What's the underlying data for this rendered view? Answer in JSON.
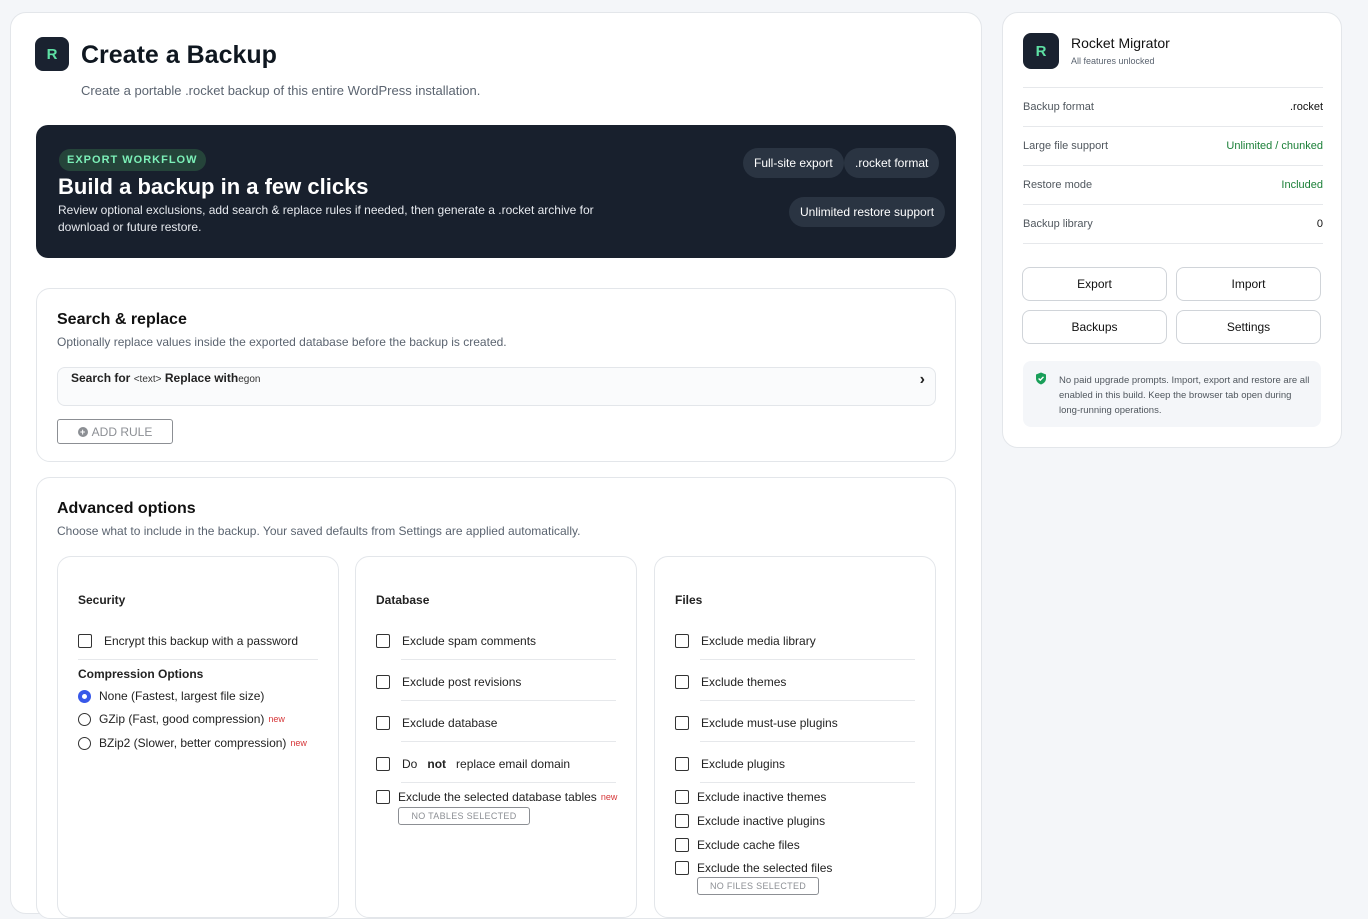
{
  "header": {
    "logo_letter": "R",
    "title": "Create a Backup",
    "subtitle": "Create a portable .rocket backup of this entire WordPress installation."
  },
  "hero": {
    "badge": "EXPORT WORKFLOW",
    "title": "Build a backup in a few clicks",
    "description": "Review optional exclusions, add search & replace rules if needed, then generate a .rocket archive for download or future restore.",
    "chips": [
      "Full-site export",
      ".rocket format",
      "Unlimited restore support"
    ]
  },
  "search_replace": {
    "title": "Search & replace",
    "description": "Optionally replace values inside the exported database before the backup is created.",
    "search_label": "Search for",
    "search_placeholder": "<text>",
    "replace_label": "Replace with",
    "replace_value": "egon",
    "add_rule_label": "ADD RULE"
  },
  "advanced": {
    "title": "Advanced options",
    "description": "Choose what to include in the backup. Your saved defaults from Settings are applied automatically.",
    "security": {
      "title": "Security",
      "encrypt_label": "Encrypt this backup with a password",
      "compression_title": "Compression Options",
      "compression": [
        {
          "label": "None (Fastest, largest file size)",
          "selected": true,
          "badge": ""
        },
        {
          "label": "GZip (Fast, good compression)",
          "selected": false,
          "badge": "new"
        },
        {
          "label": "BZip2 (Slower, better compression)",
          "selected": false,
          "badge": "new"
        }
      ]
    },
    "database": {
      "title": "Database",
      "opt1": "Exclude spam comments",
      "opt2": "Exclude post revisions",
      "opt3": "Exclude database",
      "opt4_pre": "Do",
      "opt4_bold": "not",
      "opt4_post": "replace email domain",
      "opt5": "Exclude the selected database tables",
      "opt5_badge": "new",
      "tables_button": "NO TABLES SELECTED"
    },
    "files": {
      "title": "Files",
      "opt1": "Exclude media library",
      "opt2": "Exclude themes",
      "opt3": "Exclude must-use plugins",
      "opt4": "Exclude plugins",
      "opt5": "Exclude inactive themes",
      "opt6": "Exclude inactive plugins",
      "opt7": "Exclude cache files",
      "opt8": "Exclude the selected files",
      "files_button": "NO FILES SELECTED"
    }
  },
  "sidebar": {
    "logo_letter": "R",
    "app_name": "Rocket Migrator",
    "tagline": "All features unlocked",
    "stats": [
      {
        "key": "Backup format",
        "value": ".rocket"
      },
      {
        "key": "Large file support",
        "value": "Unlimited / chunked"
      },
      {
        "key": "Restore mode",
        "value": "Included"
      },
      {
        "key": "Backup library",
        "value": "0"
      }
    ],
    "buttons": {
      "export": "Export",
      "import": "Import",
      "backups": "Backups",
      "settings": "Settings"
    },
    "notice": "No paid upgrade prompts. Import, export and restore are all enabled in this build. Keep the browser tab open during long-running operations."
  },
  "colors": {
    "accent_green": "#1a7f37",
    "hero_bg": "#18202d",
    "radio_selected": "#3858e9",
    "new_badge": "#d63638",
    "logo_bg": "#1a2230",
    "logo_fg": "#5ee0a4"
  },
  "icons": [
    "shield-check-icon",
    "chevron-right-icon",
    "plus-circle-icon"
  ]
}
